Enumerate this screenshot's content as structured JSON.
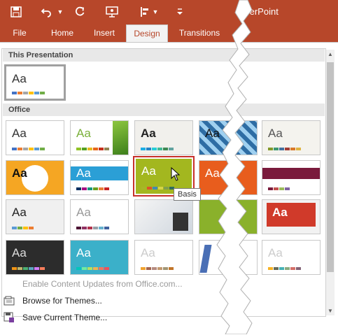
{
  "app": {
    "title": "owerPoint"
  },
  "ribbon": {
    "tabs": [
      {
        "label": "File"
      },
      {
        "label": "Home"
      },
      {
        "label": "Insert"
      },
      {
        "label": "Design",
        "active": true
      },
      {
        "label": "Transitions"
      }
    ]
  },
  "gallery": {
    "this_presentation": {
      "header": "This Presentation",
      "thumb_label": "Aa"
    },
    "office": {
      "header": "Office",
      "tooltip": "Basis",
      "thumb_label": "Aa"
    }
  },
  "menu": {
    "items": [
      {
        "label": "Enable Content Updates from Office.com...",
        "disabled": true
      },
      {
        "label": "Browse for Themes..."
      },
      {
        "label": "Save Current Theme..."
      }
    ]
  },
  "colors": {
    "accent": "#b7472a",
    "selection": "#c8302a"
  }
}
